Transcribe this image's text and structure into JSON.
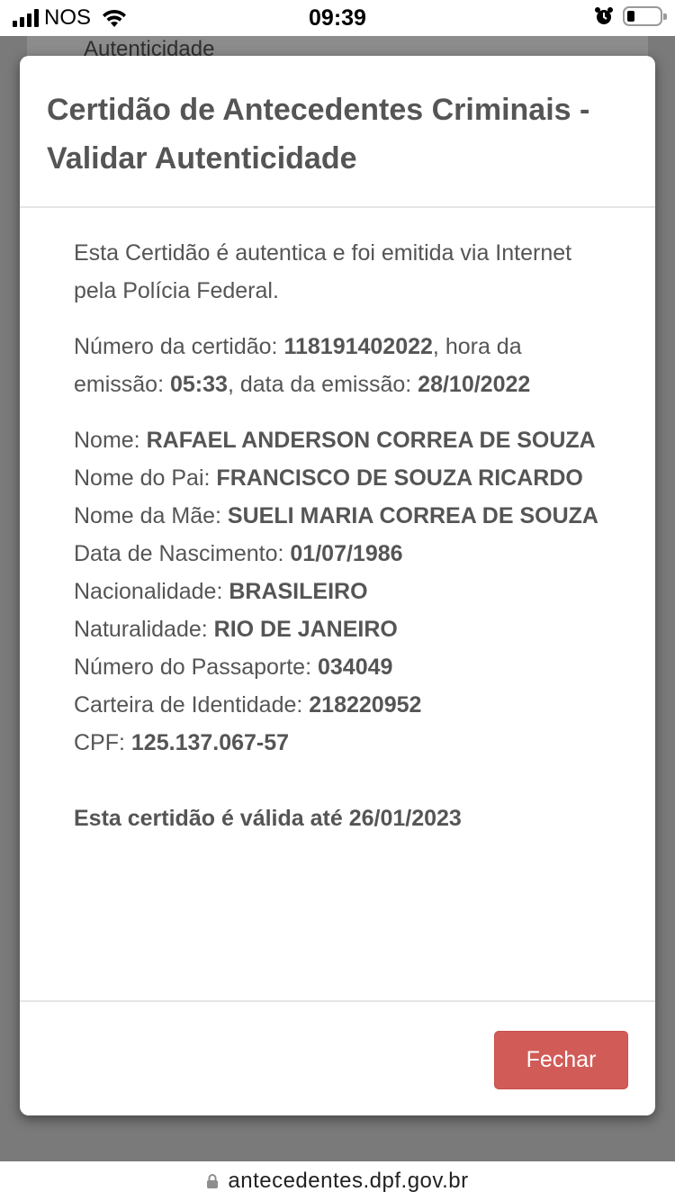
{
  "status_bar": {
    "carrier": "NOS",
    "time": "09:39"
  },
  "background": {
    "partial_text": "Autenticidade"
  },
  "modal": {
    "title": "Certidão de Antecedentes Criminais - Validar Autenticidade",
    "intro": "Esta Certidão é autentica e foi emitida via Internet pela Polícia Federal.",
    "cert_number_label": "Número da certidão: ",
    "cert_number": "118191402022",
    "emission_time_label": ", hora da emissão: ",
    "emission_time": "05:33",
    "emission_date_label": ", data da emissão: ",
    "emission_date": "28/10/2022",
    "fields": [
      {
        "label": "Nome: ",
        "value": "RAFAEL ANDERSON CORREA DE SOUZA"
      },
      {
        "label": "Nome do Pai: ",
        "value": "FRANCISCO DE SOUZA RICARDO"
      },
      {
        "label": "Nome da Mãe: ",
        "value": "SUELI MARIA CORREA DE SOUZA"
      },
      {
        "label": "Data de Nascimento: ",
        "value": "01/07/1986"
      },
      {
        "label": "Nacionalidade: ",
        "value": "BRASILEIRO"
      },
      {
        "label": "Naturalidade: ",
        "value": "RIO DE JANEIRO"
      },
      {
        "label": "Número do Passaporte: ",
        "value": "034049"
      },
      {
        "label": "Carteira de Identidade: ",
        "value": "218220952"
      },
      {
        "label": "CPF: ",
        "value": "125.137.067-57"
      }
    ],
    "validity": "Esta certidão é válida até 26/01/2023",
    "close_label": "Fechar"
  },
  "url_bar": {
    "url": "antecedentes.dpf.gov.br"
  },
  "colors": {
    "close_button": "#d15b57",
    "text": "#555555",
    "overlay": "#7a7a7a"
  }
}
